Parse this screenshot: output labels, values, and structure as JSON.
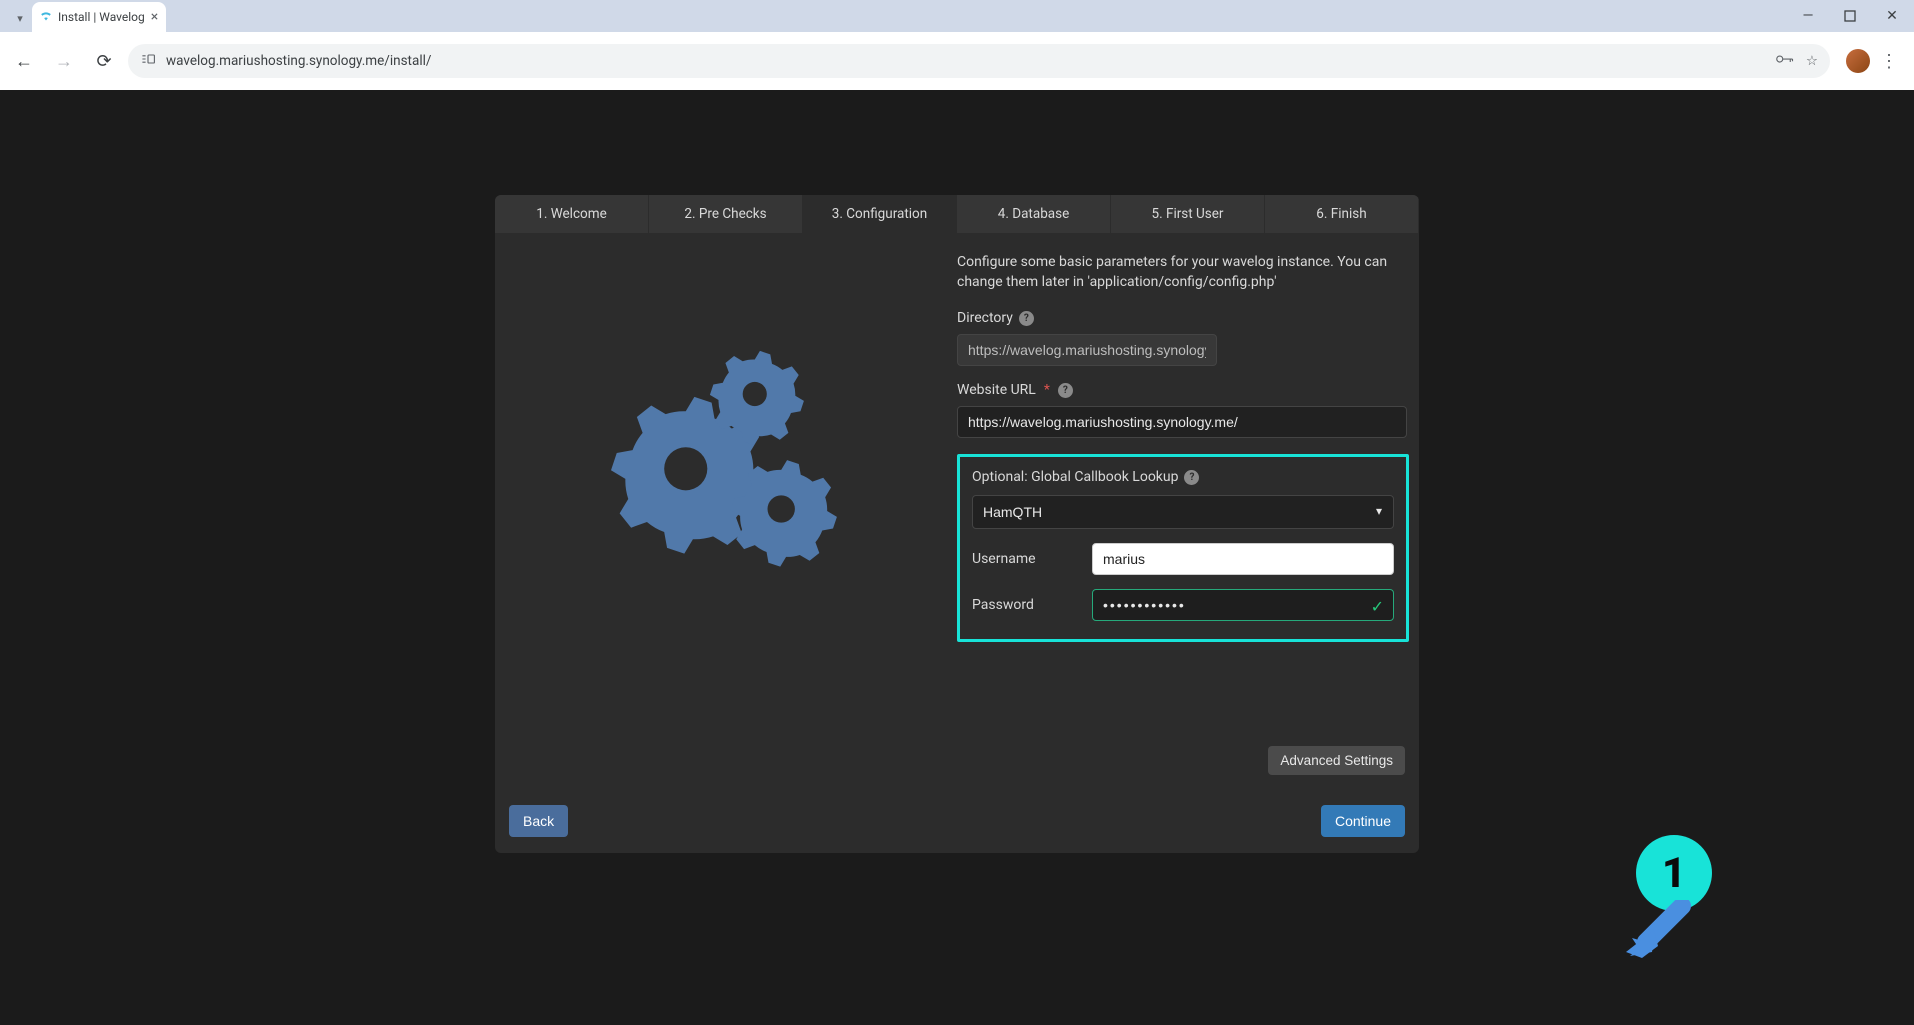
{
  "browser": {
    "tab_title": "Install | Wavelog",
    "url": "wavelog.mariushosting.synology.me/install/"
  },
  "wizard": {
    "tabs": [
      "1. Welcome",
      "2. Pre Checks",
      "3. Configuration",
      "4. Database",
      "5. First User",
      "6. Finish"
    ],
    "active_tab_index": 2,
    "intro": "Configure some basic parameters for your wavelog instance. You can change them later in 'application/config/config.php'",
    "directory": {
      "label": "Directory",
      "value": "https://wavelog.mariushosting.synology.me/"
    },
    "website_url": {
      "label": "Website URL",
      "value": "https://wavelog.mariushosting.synology.me/"
    },
    "callbook": {
      "heading": "Optional: Global Callbook Lookup",
      "selected": "HamQTH",
      "username_label": "Username",
      "username_value": "marius",
      "password_label": "Password",
      "password_value": "••••••••••••"
    },
    "advanced_label": "Advanced Settings",
    "back_label": "Back",
    "continue_label": "Continue"
  },
  "annotation": {
    "number": "1"
  }
}
